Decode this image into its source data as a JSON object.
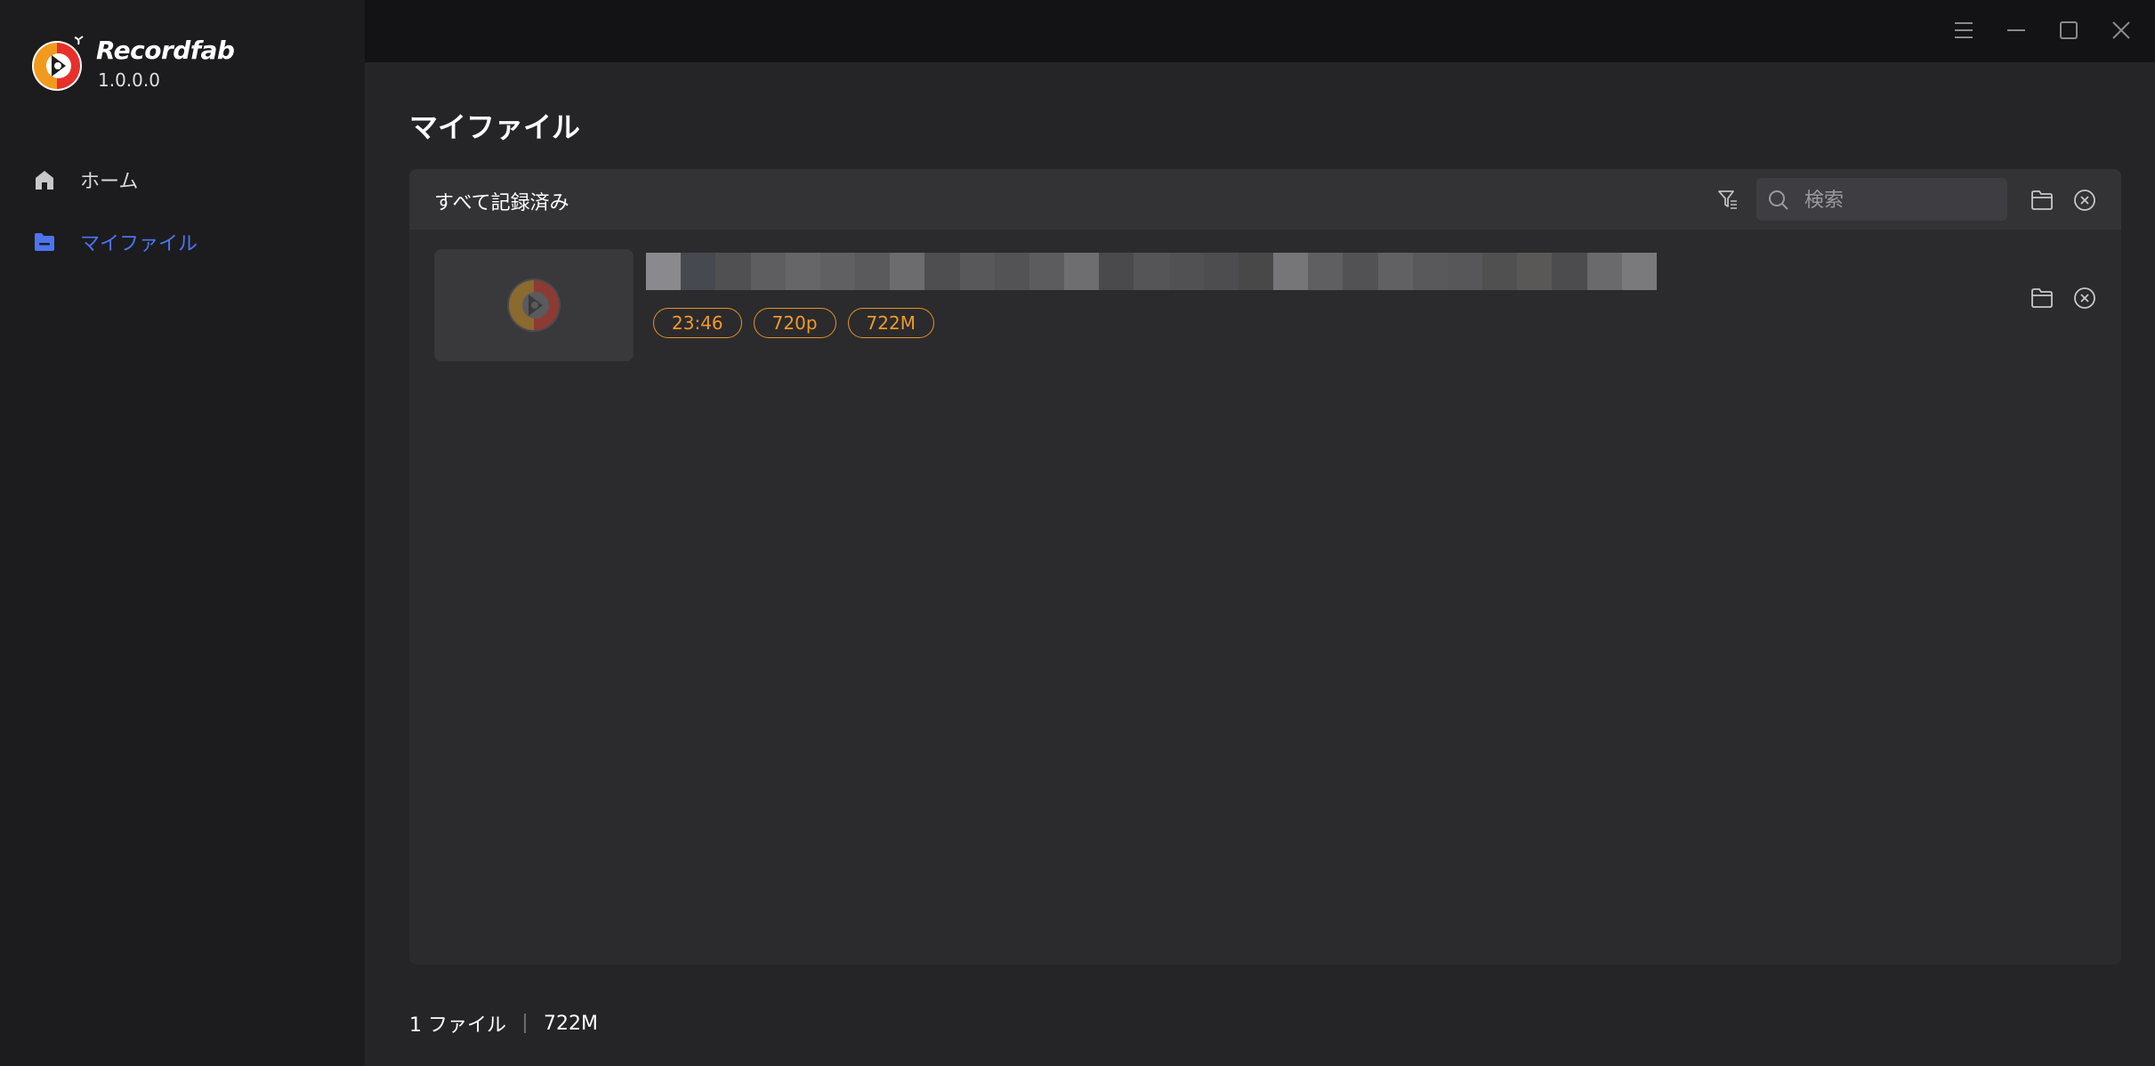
{
  "app": {
    "name": "Recordfab",
    "version": "1.0.0.0"
  },
  "sidebar": {
    "items": [
      {
        "label": "ホーム",
        "icon": "home-icon",
        "active": false
      },
      {
        "label": "マイファイル",
        "icon": "folder-icon",
        "active": true
      }
    ]
  },
  "titlebar": {
    "icons": [
      "menu-icon",
      "minimize-icon",
      "maximize-icon",
      "close-icon"
    ]
  },
  "main": {
    "title": "マイファイル",
    "filter_label": "すべて記録済み",
    "search": {
      "placeholder": "検索",
      "value": ""
    },
    "files": [
      {
        "title": "",
        "duration": "23:46",
        "resolution": "720p",
        "size": "722M"
      }
    ]
  },
  "status": {
    "count": "1 ファイル",
    "total_size": "722M"
  },
  "colors": {
    "accent": "#4d74f0",
    "tag": "#f39a26",
    "sidebar_bg": "#1c1c1e",
    "main_bg": "#252527",
    "panel_bg": "#2b2b2e"
  }
}
